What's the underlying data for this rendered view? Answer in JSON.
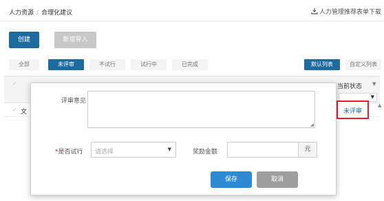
{
  "breadcrumb": {
    "root": "人力资源",
    "separator": "/",
    "current": "合理化建议"
  },
  "download_link": "人力管理推荐表单下载",
  "toolbar": {
    "create": "创建",
    "import": "新增导入"
  },
  "filter_tabs": [
    "全部",
    "未评审",
    "不试行",
    "试行中",
    "已完成"
  ],
  "active_tab": "未评审",
  "view_tabs": [
    "默认列表",
    "自定义列表"
  ],
  "active_view": "默认列表",
  "table": {
    "status_header": "当前状态",
    "row_first_char": "文",
    "row_status": "未评审"
  },
  "modal": {
    "opinion_label": "评审意见",
    "trial_required_mark": "*",
    "trial_label": "是否试行",
    "trial_placeholder": "请选择",
    "amount_label": "奖励金额",
    "amount_unit": "元",
    "save": "保存",
    "cancel": "取消"
  },
  "colors": {
    "primary": "#1d6a9f",
    "save": "#2e8bd3",
    "highlight": "#e0202a"
  }
}
